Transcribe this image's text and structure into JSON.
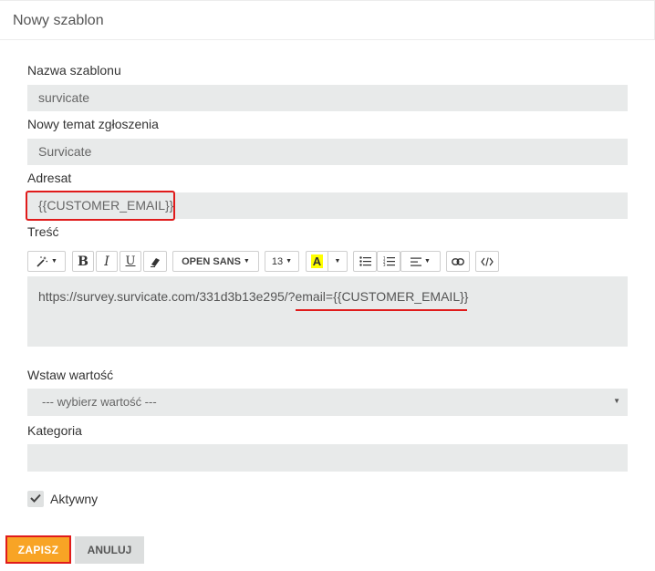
{
  "header": {
    "title": "Nowy szablon"
  },
  "form": {
    "template_name": {
      "label": "Nazwa szablonu",
      "value": "survicate"
    },
    "subject": {
      "label": "Nowy temat zgłoszenia",
      "value": "Survicate"
    },
    "recipient": {
      "label": "Adresat",
      "value": "{{CUSTOMER_EMAIL}}"
    },
    "content": {
      "label": "Treść",
      "value": "https://survey.survicate.com/331d3b13e295/?email={{CUSTOMER_EMAIL}}"
    },
    "insert_value": {
      "label": "Wstaw wartość",
      "selected": "--- wybierz wartość ---"
    },
    "category": {
      "label": "Kategoria",
      "value": ""
    },
    "active": {
      "label": "Aktywny",
      "checked": true
    }
  },
  "toolbar": {
    "bold": "B",
    "italic": "I",
    "underline": "U",
    "font_family": "OPEN SANS",
    "font_size": "13",
    "color_letter": "A",
    "highlight_color": "#ffff00",
    "icons": [
      "magic-wand-icon",
      "eraser-icon",
      "unordered-list-icon",
      "ordered-list-icon",
      "align-icon",
      "link-icon",
      "code-view-icon"
    ]
  },
  "buttons": {
    "save": "ZAPISZ",
    "cancel": "ANULUJ"
  },
  "colors": {
    "accent": "#f8a425",
    "highlight_border": "#e01b1b",
    "field_bg": "#e8eaea"
  }
}
